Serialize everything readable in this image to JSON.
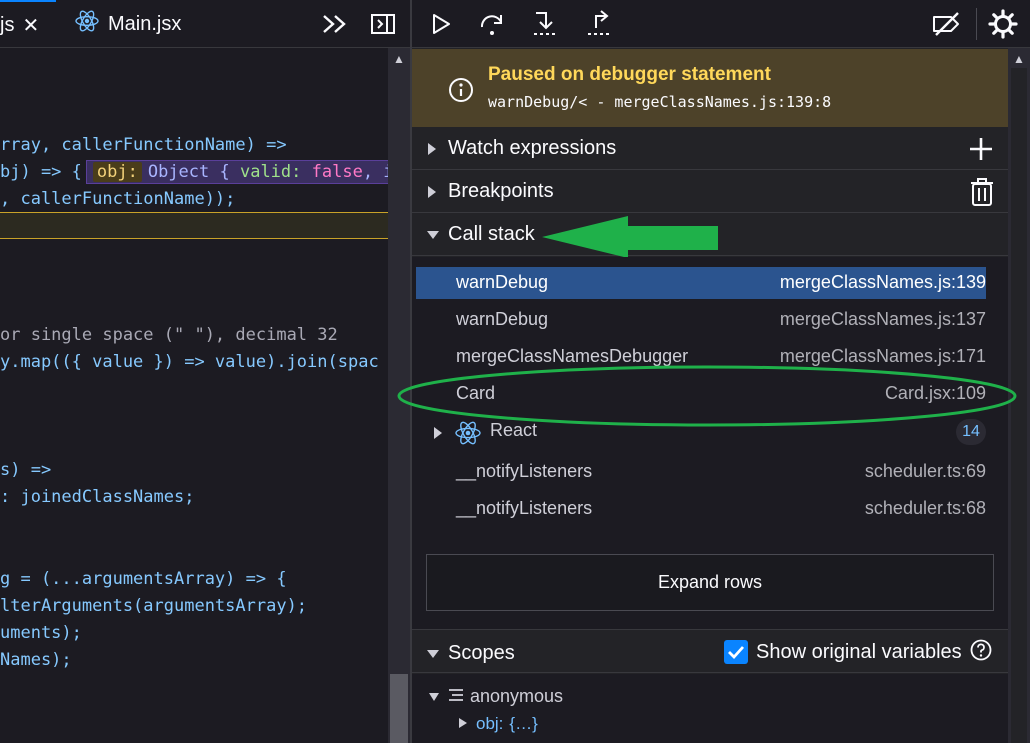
{
  "editor": {
    "tabs": [
      {
        "label": "js",
        "close": "✕"
      },
      {
        "label": "Main.jsx"
      }
    ],
    "code_lines": [
      {
        "id": "l1",
        "text": "rray, callerFunctionName) =>"
      },
      {
        "id": "l2",
        "text": "bj) => {"
      },
      {
        "id": "l3",
        "text": ", callerFunctionName));"
      },
      {
        "id": "l4",
        "text": ""
      },
      {
        "id": "l5",
        "text": "or single space (\" \"), decimal 32"
      },
      {
        "id": "l6",
        "text": "y.map(({ value }) => value).join(spac"
      },
      {
        "id": "l7",
        "text": "s) =>"
      },
      {
        "id": "l8",
        "text": ": joinedClassNames;"
      },
      {
        "id": "l9",
        "text": "g = (...argumentsArray) => {"
      },
      {
        "id": "l10",
        "text": "lterArguments(argumentsArray);"
      },
      {
        "id": "l11",
        "text": "uments);"
      },
      {
        "id": "l12",
        "text": "Names);"
      }
    ],
    "annotation": {
      "key": "obj:",
      "prefix": "Object { ",
      "field": "valid:",
      "value": "false",
      "suffix": ", i"
    }
  },
  "debugger": {
    "paused": {
      "title": "Paused on debugger statement",
      "location": "warnDebug/< - mergeClassNames.js:139:8"
    },
    "sections": {
      "watch": "Watch expressions",
      "breakpoints": "Breakpoints",
      "callstack": "Call stack",
      "scopes": "Scopes"
    },
    "frames": [
      {
        "name": "warnDebug",
        "location": "mergeClassNames.js:139",
        "selected": true
      },
      {
        "name": "warnDebug",
        "location": "mergeClassNames.js:137"
      },
      {
        "name": "mergeClassNamesDebugger",
        "location": "mergeClassNames.js:171"
      },
      {
        "name": "Card",
        "location": "Card.jsx:109"
      },
      {
        "name": "__notifyListeners",
        "location": "scheduler.ts:69"
      },
      {
        "name": "__notifyListeners",
        "location": "scheduler.ts:68"
      }
    ],
    "react_group": {
      "label": "React",
      "count": "14"
    },
    "expand_rows": "Expand rows",
    "show_original_variables": "Show original variables",
    "scope_tree": {
      "anonymous": "anonymous",
      "obj_key": "obj:",
      "obj_value": "{…}"
    }
  },
  "colors": {
    "accent": "#0a84ff",
    "selection": "#2b548f",
    "pause_banner": "#4d4229",
    "pause_title": "#ffd85a",
    "annotation_green": "#1fb14a"
  }
}
